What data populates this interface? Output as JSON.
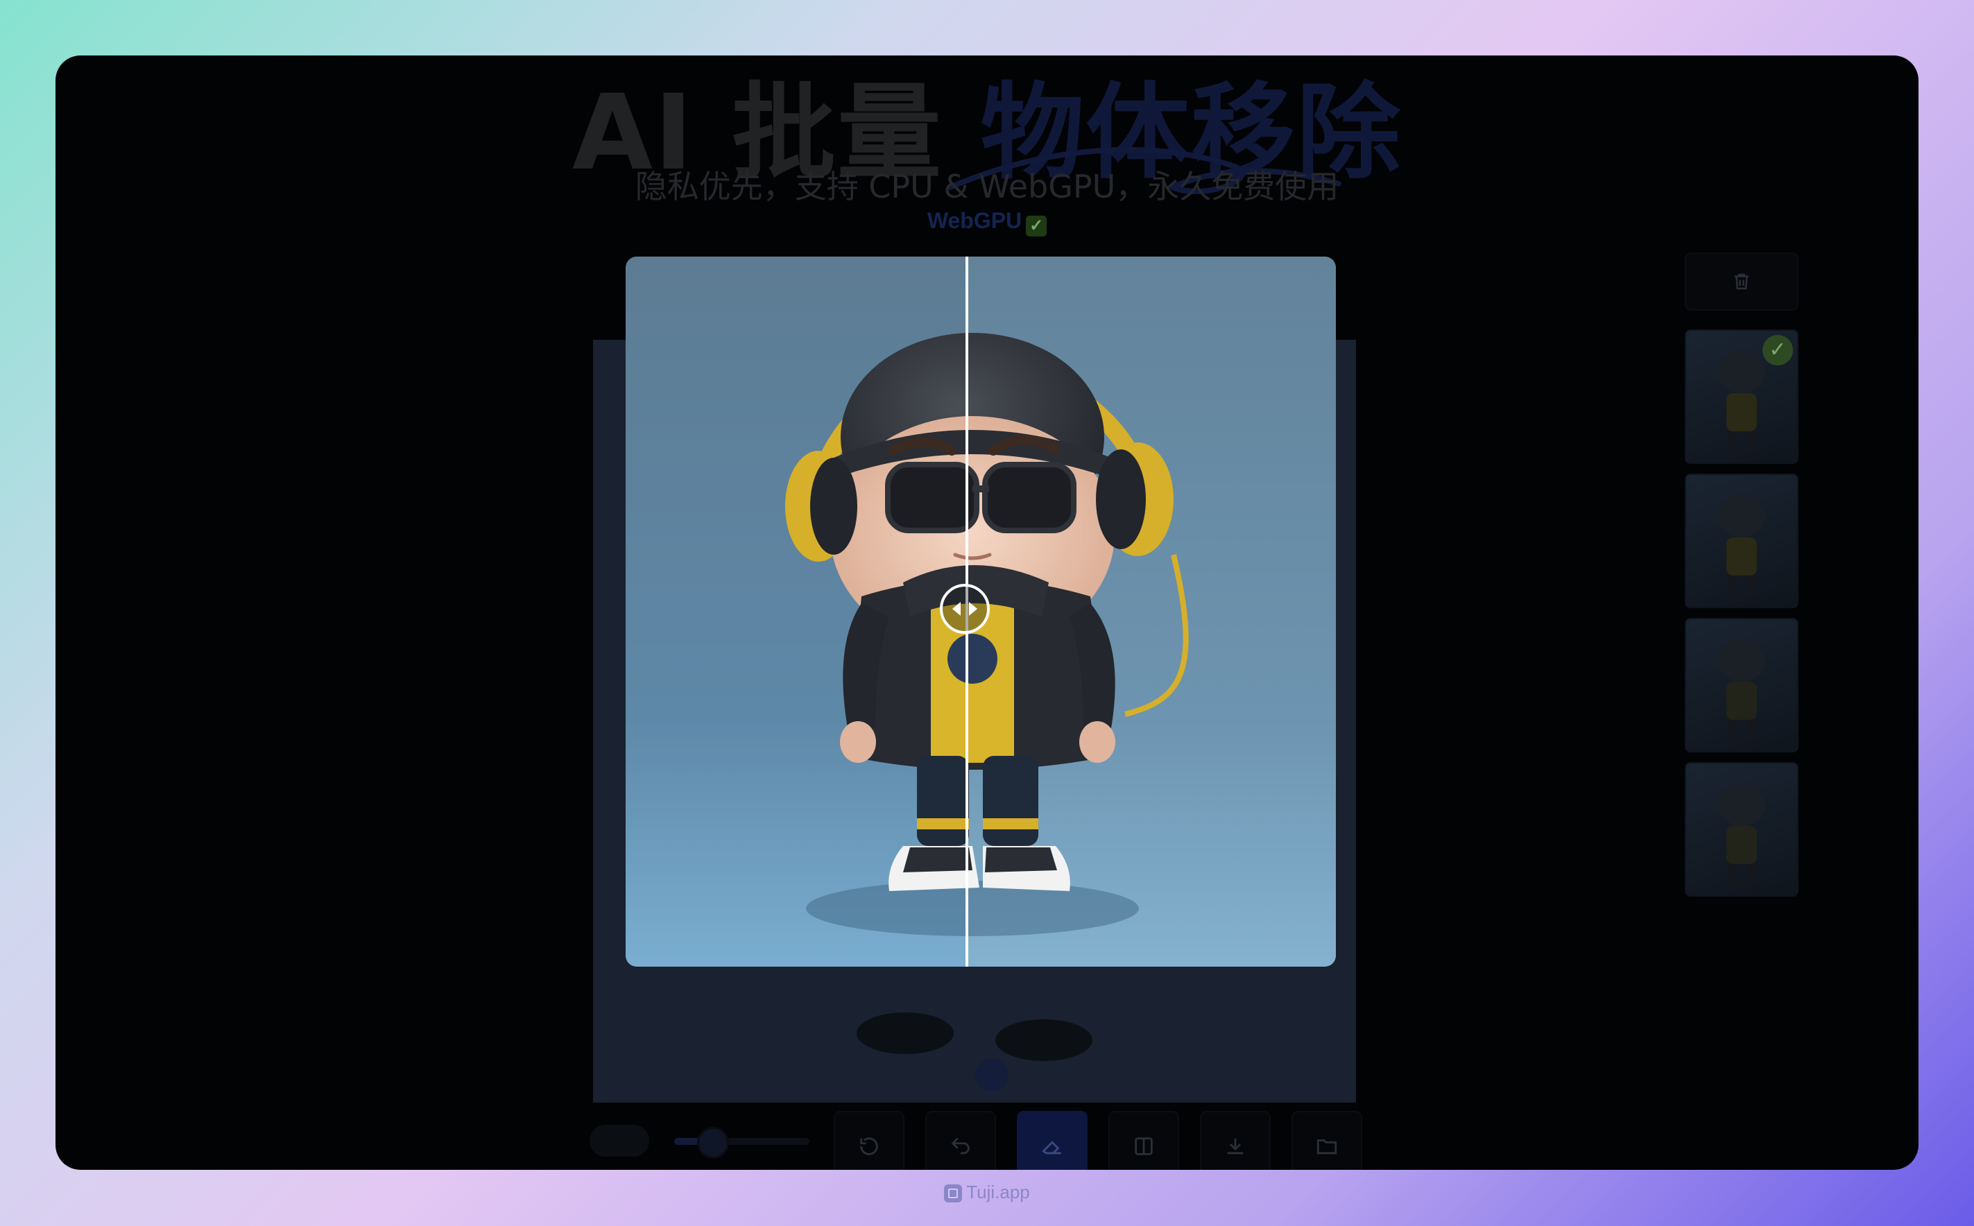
{
  "header": {
    "title_part1": "AI 批量",
    "title_part2": "物体移除",
    "subtitle": "隐私优先，支持 CPU & WebGPU，永久免费使用",
    "badge": "WebGPU",
    "badge_check": "✓"
  },
  "sidebar": {
    "delete_icon": "trash-icon",
    "thumbnails": [
      {
        "selected": true
      },
      {
        "selected": false
      },
      {
        "selected": false
      },
      {
        "selected": false
      }
    ],
    "thumb_check": "✓"
  },
  "toolbar": {
    "brush_size_fraction": 0.28,
    "buttons": [
      "reset-icon",
      "undo-icon",
      "eraser-icon",
      "compare-icon",
      "download-icon",
      "save-folder-icon"
    ],
    "active_button": "eraser-icon"
  },
  "compare_view": {
    "split_fraction": 0.48,
    "handle_icon": "left-right-arrows-icon"
  },
  "footer": {
    "brand": "Tuji.app"
  },
  "colors": {
    "accent": "#1f3a8a",
    "window_bg": "#020305",
    "background_gradient_start": "#86e3cf",
    "background_gradient_end": "#6a5ce8"
  }
}
